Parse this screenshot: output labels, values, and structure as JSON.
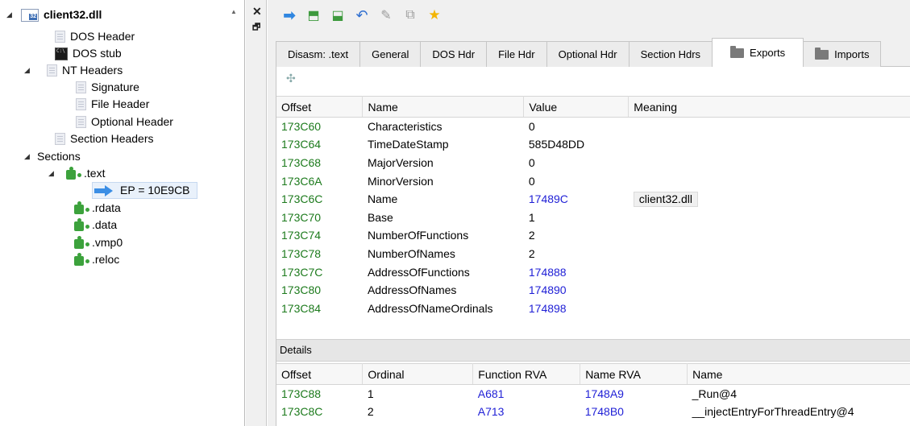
{
  "tree": {
    "root": "client32.dll",
    "dos_header": "DOS Header",
    "dos_stub": "DOS stub",
    "nt_headers": "NT Headers",
    "signature": "Signature",
    "file_header": "File Header",
    "optional_header": "Optional Header",
    "section_headers": "Section Headers",
    "sections": "Sections",
    "text": ".text",
    "ep": "EP = 10E9CB",
    "rdata": ".rdata",
    "data": ".data",
    "vmp0": ".vmp0",
    "reloc": ".reloc"
  },
  "side": {
    "close": "✕",
    "restore": "🗗"
  },
  "toolbar": {
    "icons": [
      "arrow-right-icon",
      "import-icon",
      "export-icon",
      "undo-icon",
      "pin-icon",
      "copy-icon",
      "star-icon"
    ],
    "glyphs": [
      "➡",
      "⬒",
      "⬓",
      "↶",
      "✎",
      "⧉",
      "★"
    ]
  },
  "tabs": [
    "Disasm: .text",
    "General",
    "DOS Hdr",
    "File Hdr",
    "Optional Hdr",
    "Section Hdrs",
    "Exports",
    "Imports"
  ],
  "active_tab": "Exports",
  "exports": {
    "columns": [
      "Offset",
      "Name",
      "Value",
      "Meaning"
    ],
    "rows": [
      {
        "offset": "173C60",
        "name": "Characteristics",
        "value": "0",
        "meaning": ""
      },
      {
        "offset": "173C64",
        "name": "TimeDateStamp",
        "value": "585D48DD",
        "meaning": ""
      },
      {
        "offset": "173C68",
        "name": "MajorVersion",
        "value": "0",
        "meaning": ""
      },
      {
        "offset": "173C6A",
        "name": "MinorVersion",
        "value": "0",
        "meaning": ""
      },
      {
        "offset": "173C6C",
        "name": "Name",
        "value": "17489C",
        "meaning": "client32.dll"
      },
      {
        "offset": "173C70",
        "name": "Base",
        "value": "1",
        "meaning": ""
      },
      {
        "offset": "173C74",
        "name": "NumberOfFunctions",
        "value": "2",
        "meaning": ""
      },
      {
        "offset": "173C78",
        "name": "NumberOfNames",
        "value": "2",
        "meaning": ""
      },
      {
        "offset": "173C7C",
        "name": "AddressOfFunctions",
        "value": "174888",
        "meaning": ""
      },
      {
        "offset": "173C80",
        "name": "AddressOfNames",
        "value": "174890",
        "meaning": ""
      },
      {
        "offset": "173C84",
        "name": "AddressOfNameOrdinals",
        "value": "174898",
        "meaning": ""
      }
    ]
  },
  "details": {
    "label": "Details",
    "columns": [
      "Offset",
      "Ordinal",
      "Function RVA",
      "Name RVA",
      "Name"
    ],
    "rows": [
      {
        "offset": "173C88",
        "ordinal": "1",
        "func_rva": "A681",
        "name_rva": "1748A9",
        "name": "_Run@4"
      },
      {
        "offset": "173C8C",
        "ordinal": "2",
        "func_rva": "A713",
        "name_rva": "1748B0",
        "name": "__injectEntryForThreadEntry@4"
      }
    ]
  },
  "colors": {
    "offset": "#1c7a1c",
    "address": "#1f1fd6",
    "tree_selection": "#e9f1fb"
  }
}
